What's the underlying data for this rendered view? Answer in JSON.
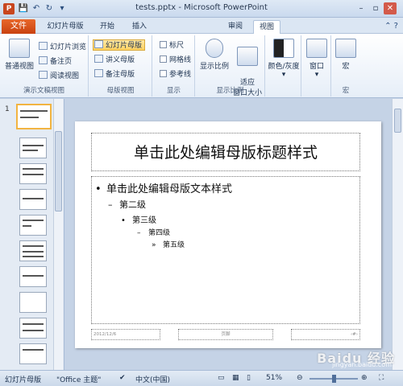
{
  "window": {
    "title": "tests.pptx - Microsoft PowerPoint",
    "app_icon": "P"
  },
  "quick_access": {
    "save": "save-icon",
    "undo": "undo-icon",
    "redo": "redo-icon"
  },
  "tabs": {
    "file": "文件",
    "items": [
      "幻灯片母版",
      "开始",
      "插入",
      "审阅",
      "视图"
    ],
    "active": "视图"
  },
  "ribbon": {
    "presentation_views": {
      "label": "演示文稿视图",
      "normal": "普通视图",
      "slide_sorter": "幻灯片浏览",
      "notes_page": "备注页",
      "reading_view": "阅读视图"
    },
    "master_views": {
      "label": "母版视图",
      "slide_master": "幻灯片母版",
      "handout_master": "讲义母版",
      "notes_master": "备注母版"
    },
    "show": {
      "label": "显示",
      "ruler": "标尺",
      "gridlines": "网格线",
      "guides": "参考线"
    },
    "zoom": {
      "label": "显示比例",
      "zoom": "显示比例",
      "fit": "适应\n窗口大小"
    },
    "color": {
      "color_gray": "颜色/灰度"
    },
    "window": {
      "window": "窗口"
    },
    "macro": {
      "label": "宏",
      "macro": "宏"
    }
  },
  "thumbnails": {
    "first_number": "1"
  },
  "slide": {
    "title": "单击此处编辑母版标题样式",
    "levels": [
      "单击此处编辑母版文本样式",
      "第二级",
      "第三级",
      "第四级",
      "第五级"
    ],
    "footer_date": "2012/12/6",
    "footer_text": "页脚",
    "footer_num": "‹#›"
  },
  "status": {
    "view": "幻灯片母版",
    "theme": "\"Office 主题\"",
    "language": "中文(中国)",
    "zoom": "51%"
  },
  "watermark": {
    "brand": "Baidu 经验",
    "url": "jingyan.baidu.com"
  }
}
